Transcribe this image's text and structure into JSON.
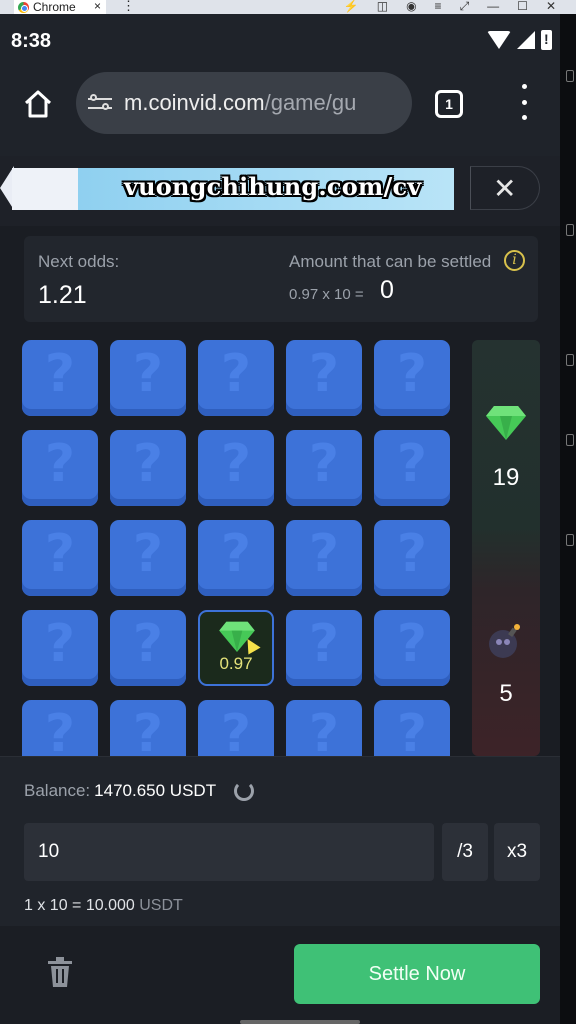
{
  "window": {
    "tab_title": "Chrome",
    "tab_close": "×",
    "dots": "⋮"
  },
  "status_bar": {
    "time": "8:38"
  },
  "browser": {
    "url_host": "m.coinvid.com",
    "url_path": "/game/gu",
    "tab_count": "1"
  },
  "banner": {
    "watermark": "vuongchihung.com/cv",
    "close": "✕"
  },
  "odds": {
    "next_label": "Next odds:",
    "next_value": "1.21",
    "settle_label": "Amount that can be settled",
    "info_icon": "i",
    "settle_formula": "0.97 x 10 =",
    "settle_value": "0"
  },
  "grid": {
    "rows": 5,
    "cols": 5,
    "hidden_symbol": "?",
    "revealed": [
      {
        "row": 3,
        "col": 2,
        "value": "0.97"
      }
    ]
  },
  "sidebar": {
    "gem_count": "19",
    "bomb_count": "5"
  },
  "balance": {
    "label": "Balance:",
    "value": "1470.650 USDT"
  },
  "bet": {
    "amount": "10",
    "divide_label": "/3",
    "multiply_label": "x3",
    "calc_expression": "1 x 10 = 10.000",
    "calc_unit": "USDT"
  },
  "footer": {
    "settle_label": "Settle Now"
  },
  "colors": {
    "tile": "#3d72d8",
    "settle_button": "#3fc176",
    "gem": "#4cd05c",
    "info_accent": "#d8c14c"
  }
}
